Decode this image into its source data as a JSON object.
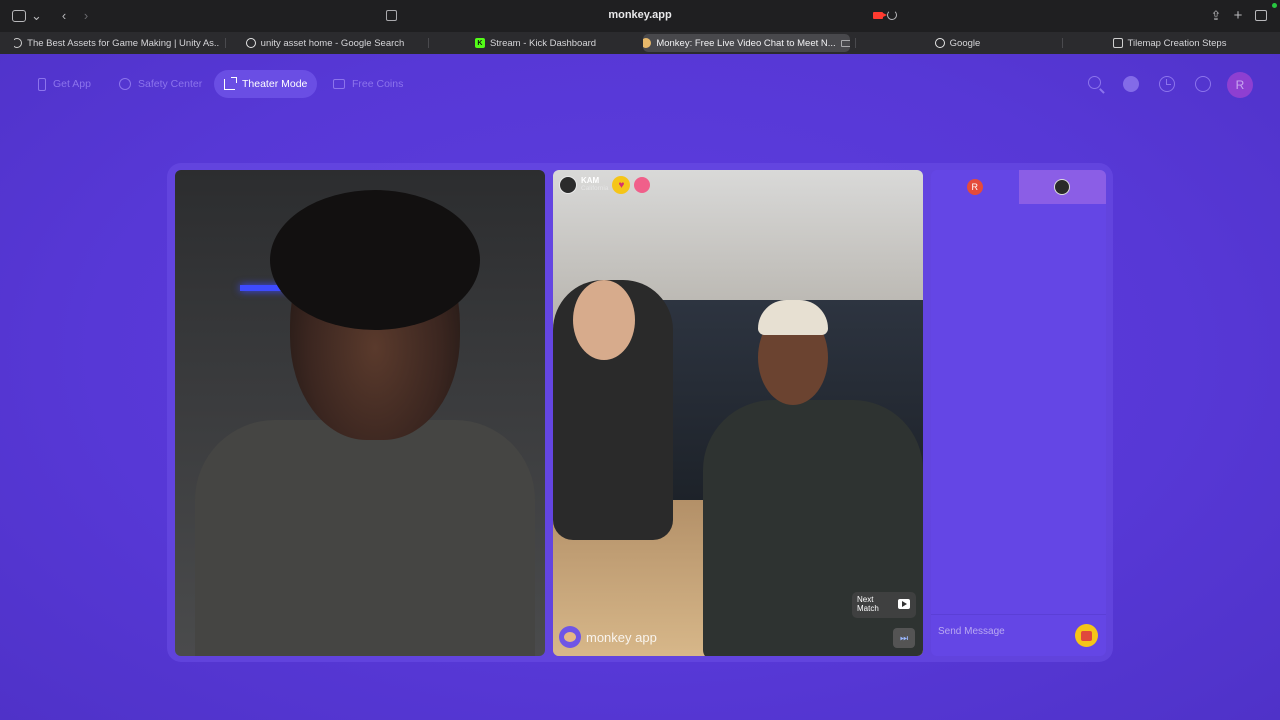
{
  "browser": {
    "url": "monkey.app",
    "tabs": [
      {
        "label": "The Best Assets for Game Making | Unity As...",
        "favicon": "unity-icon"
      },
      {
        "label": "unity asset home - Google Search",
        "favicon": "google-icon"
      },
      {
        "label": "Stream - Kick Dashboard",
        "favicon": "kick-icon"
      },
      {
        "label": "Monkey: Free Live Video Chat to Meet N...",
        "favicon": "monkey-icon",
        "active": true
      },
      {
        "label": "Google",
        "favicon": "google-icon"
      },
      {
        "label": "Tilemap Creation Steps",
        "favicon": "tilemap-icon"
      }
    ]
  },
  "nav": {
    "get_app": "Get App",
    "safety_center": "Safety Center",
    "theater_mode": "Theater Mode",
    "free_coins": "Free Coins"
  },
  "header": {
    "avatar_initial": "R"
  },
  "peer": {
    "name": "KAM",
    "location": "California",
    "logo_text": "monkey app",
    "next_match_label": "Next\nMatch"
  },
  "chat": {
    "self_initial": "R",
    "placeholder": "Send Message"
  },
  "colors": {
    "page_bg": "#5a3ad8",
    "accent": "#6a4ee4",
    "gift": "#f5c518"
  }
}
